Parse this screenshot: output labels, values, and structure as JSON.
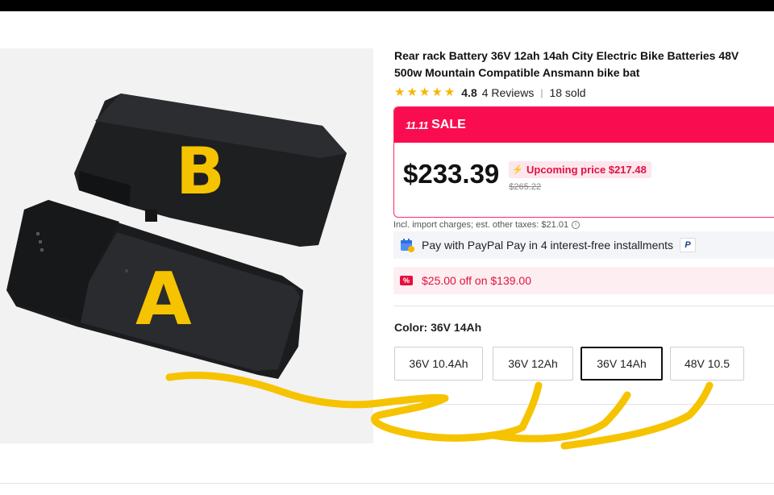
{
  "product": {
    "title_line1": "Rear rack Battery 36V 12ah 14ah City Electric Bike Batteries 48V",
    "title_line2": "500w Mountain Compatible Ansmann bike bat",
    "rating": "4.8",
    "reviews": "4 Reviews",
    "sold": "18 sold",
    "star_count": 5
  },
  "sale": {
    "badge": "11.11",
    "label": "SALE",
    "price": "$233.39",
    "upcoming": "Upcoming price $217.48",
    "old_price": "$265.22"
  },
  "tax_note": "Incl. import charges; est. other taxes: $21.01",
  "paypal": {
    "text": "Pay with PayPal Pay in 4 interest-free installments",
    "icon_text": "P"
  },
  "coupon": {
    "icon_text": "%",
    "text": "$25.00 off on $139.00"
  },
  "color": {
    "label": "Color: 36V 14Ah",
    "options": [
      "36V 10.4Ah",
      "36V 12Ah",
      "36V 14Ah",
      "48V 10.5"
    ],
    "selected": "36V 14Ah"
  },
  "annotations": {
    "letter_b": "B",
    "letter_a": "A"
  },
  "colors": {
    "sale_red": "#fa0d50",
    "star": "#f7b500",
    "annotation_yellow": "#f6c300"
  },
  "icons": [
    "star-icon",
    "bolt-icon",
    "info-icon",
    "calendar-icon",
    "paypal-icon",
    "coupon-icon"
  ]
}
